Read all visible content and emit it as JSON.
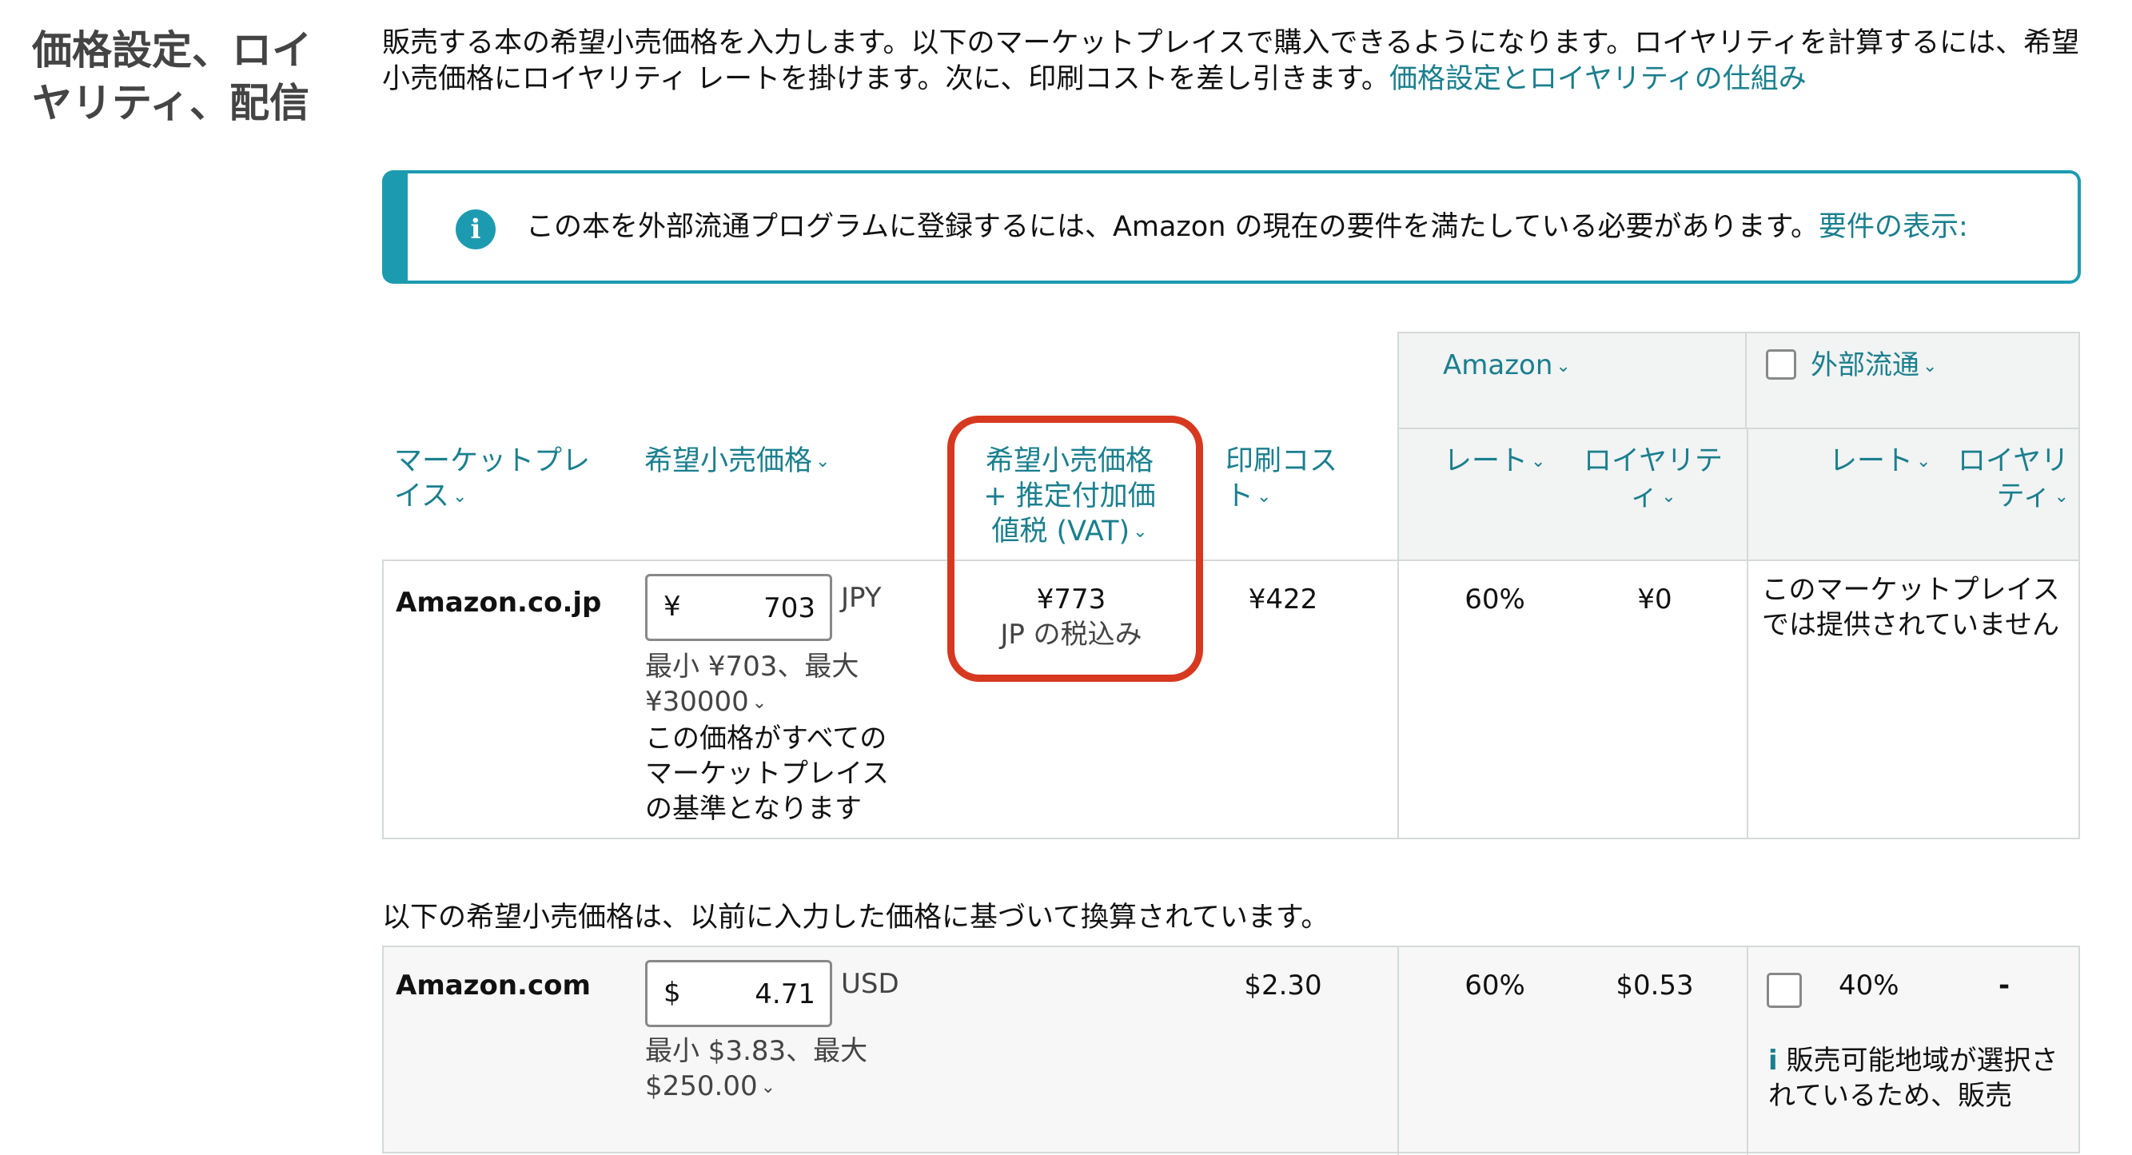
{
  "section": {
    "title": "価格設定、ロイヤリティ、配信"
  },
  "description": {
    "text": "販売する本の希望小売価格を入力します。以下のマーケットプレイスで購入できるようになります。ロイヤリティを計算するには、希望小売価格にロイヤリティ レートを掛けます。次に、印刷コストを差し引きます。",
    "link": "価格設定とロイヤリティの仕組み"
  },
  "alert": {
    "icon": "info-icon",
    "text": "この本を外部流通プログラムに登録するには、Amazon の現在の要件を満たしている必要があります。",
    "link": "要件の表示:"
  },
  "table": {
    "group_amazon": "Amazon",
    "group_external": "外部流通",
    "headers": {
      "marketplace": "マーケットプレイス",
      "list_price": "希望小売価格",
      "price_vat": "希望小売価格 + 推定付加価値税 (VAT)",
      "print_cost": "印刷コスト",
      "rate": "レート",
      "royalty": "ロイヤリティ",
      "ext_rate": "レート",
      "ext_royalty": "ロイヤリティ"
    },
    "rows": [
      {
        "marketplace": "Amazon.co.jp",
        "currency_symbol": "¥",
        "price": "703",
        "currency": "JPY",
        "min_max": "最小 ¥703、最大 ¥30000",
        "base_note": "この価格がすべてのマーケットプレイスの基準となります",
        "price_vat": "¥773",
        "vat_note": "JP の税込み",
        "print_cost": "¥422",
        "rate": "60%",
        "royalty": "¥0",
        "external": "このマーケットプレイスでは提供されていません"
      },
      {
        "marketplace": "Amazon.com",
        "currency_symbol": "$",
        "price": "4.71",
        "currency": "USD",
        "min_max": "最小 $3.83、最大 $250.00",
        "print_cost": "$2.30",
        "rate": "60%",
        "royalty": "$0.53",
        "ext_rate": "40%",
        "ext_royalty": "-",
        "ext_note": "販売可能地域が選択されているため、販売"
      }
    ],
    "converted_note": "以下の希望小売価格は、以前に入力した価格に基づいて換算されています。"
  }
}
